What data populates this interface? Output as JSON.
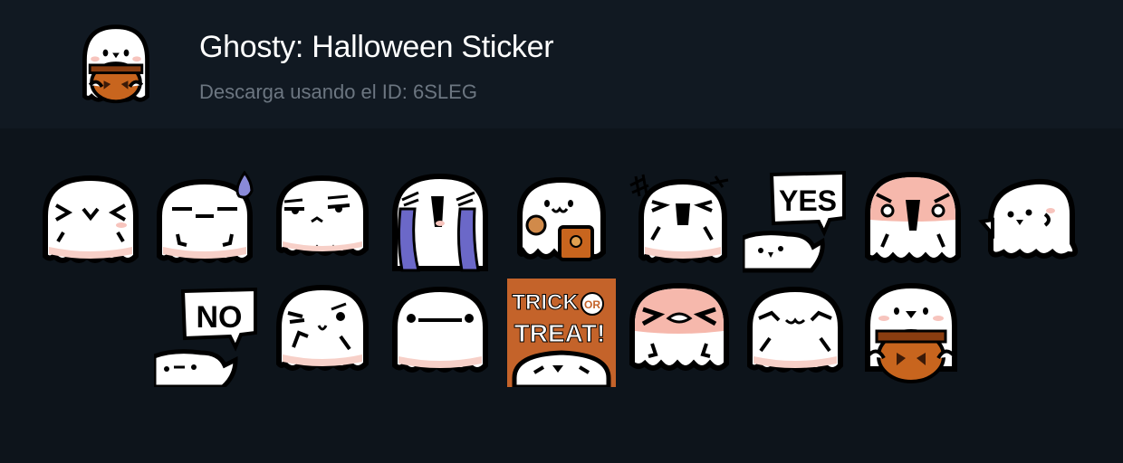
{
  "pack": {
    "title": "Ghosty: Halloween Sticker",
    "subtitle": "Descarga usando el ID: 6SLEG",
    "icon": "ghost-pumpkin-icon"
  },
  "colors": {
    "background": "#0d141b",
    "header_background": "#111922",
    "title": "#ffffff",
    "subtitle": "#6c7681",
    "ghost_body": "#ffffff",
    "ghost_outline": "#000000",
    "ghost_blush": "#f7d0c8",
    "pumpkin": "#c8651e",
    "tears": "#6b68c8",
    "trick_bg": "#c4632a"
  },
  "sticker_rows": [
    [
      {
        "name": "ghost-squint-sticker"
      },
      {
        "name": "ghost-sweat-sticker"
      },
      {
        "name": "ghost-annoyed-sticker"
      },
      {
        "name": "ghost-crying-sticker"
      },
      {
        "name": "ghost-cookie-sticker"
      },
      {
        "name": "ghost-angry-scream-sticker"
      },
      {
        "name": "ghost-yes-sign-sticker",
        "text": "YES"
      },
      {
        "name": "ghost-shocked-blush-sticker"
      },
      {
        "name": "ghost-peek-sticker"
      }
    ],
    [
      {
        "name": "ghost-no-sign-sticker",
        "text": "NO"
      },
      {
        "name": "ghost-wink-sticker"
      },
      {
        "name": "ghost-blank-sticker"
      },
      {
        "name": "ghost-trick-or-treat-sticker",
        "text_top": "TRICK",
        "text_or": "OR",
        "text_bottom": "TREAT!"
      },
      {
        "name": "ghost-mad-blush-sticker"
      },
      {
        "name": "ghost-happy-squint-sticker"
      },
      {
        "name": "ghost-pumpkin-sticker"
      }
    ]
  ]
}
